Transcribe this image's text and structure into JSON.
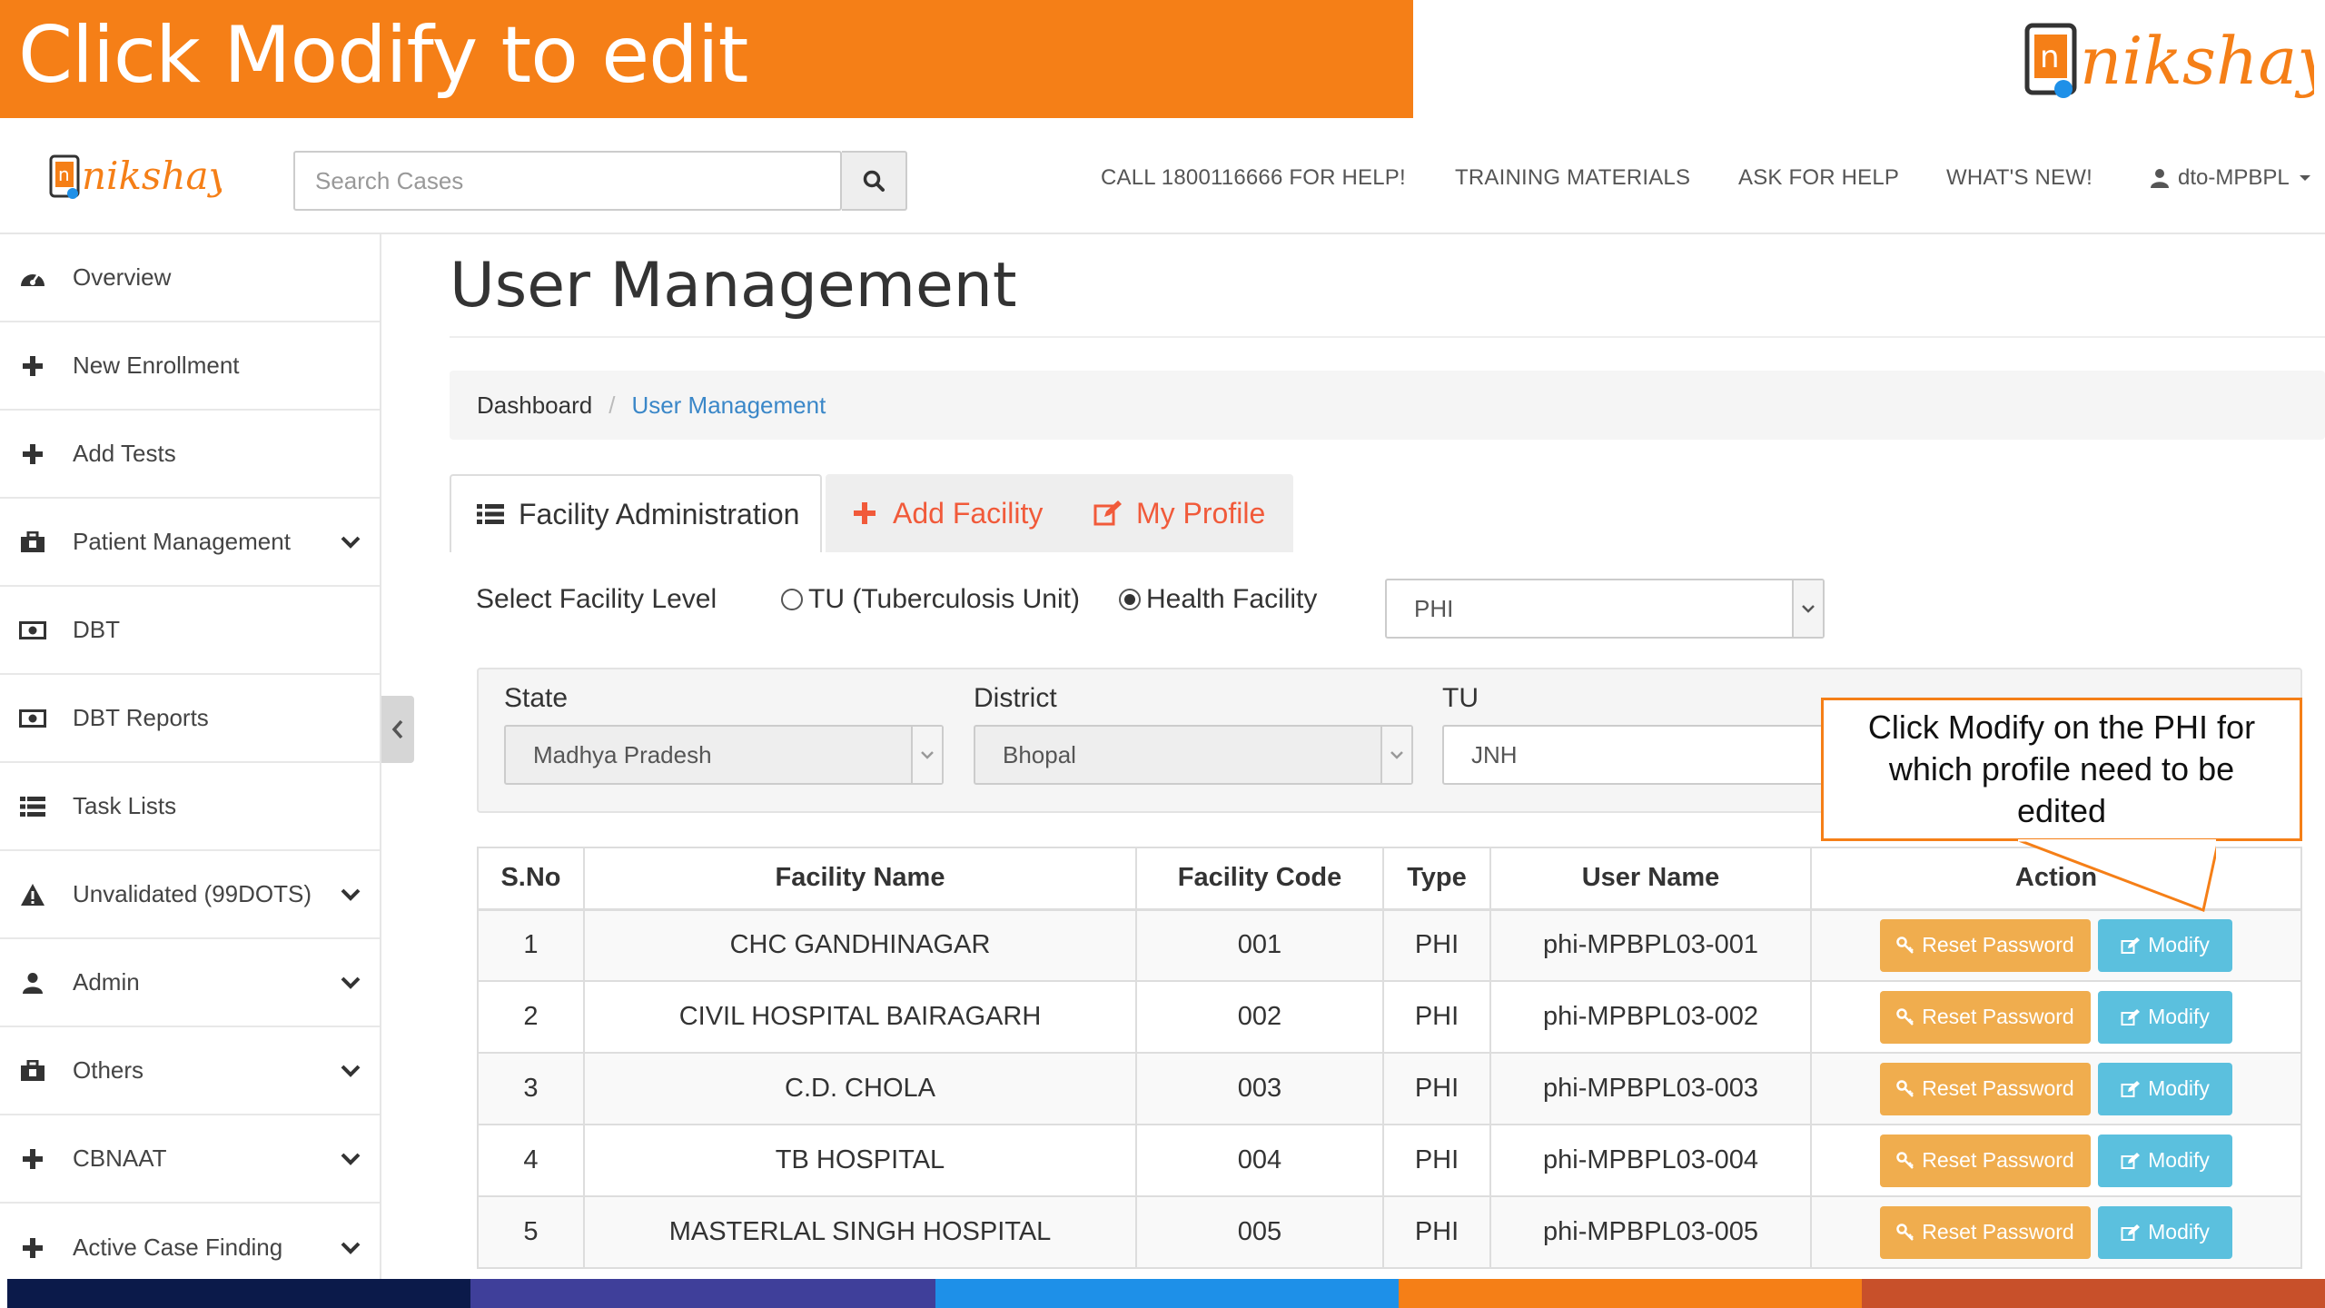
{
  "banner": {
    "text": "Click Modify to edit"
  },
  "brand": {
    "logo_text": "nikshay"
  },
  "header": {
    "search_placeholder": "Search Cases",
    "links": [
      "CALL 1800116666 FOR HELP!",
      "TRAINING MATERIALS",
      "ASK FOR HELP",
      "WHAT'S NEW!"
    ],
    "user": "dto-MPBPL"
  },
  "sidebar": {
    "items": [
      {
        "label": "Overview",
        "icon": "dashboard-icon",
        "expandable": false
      },
      {
        "label": "New Enrollment",
        "icon": "plus-icon",
        "expandable": false
      },
      {
        "label": "Add Tests",
        "icon": "plus-icon",
        "expandable": false
      },
      {
        "label": "Patient Management",
        "icon": "briefcase-icon",
        "expandable": true
      },
      {
        "label": "DBT",
        "icon": "money-icon",
        "expandable": false
      },
      {
        "label": "DBT Reports",
        "icon": "money-icon",
        "expandable": false
      },
      {
        "label": "Task Lists",
        "icon": "list-icon",
        "expandable": false
      },
      {
        "label": "Unvalidated (99DOTS)",
        "icon": "warning-icon",
        "expandable": true
      },
      {
        "label": "Admin",
        "icon": "user-icon",
        "expandable": true
      },
      {
        "label": "Others",
        "icon": "briefcase-icon",
        "expandable": true
      },
      {
        "label": "CBNAAT",
        "icon": "plus-icon",
        "expandable": true
      },
      {
        "label": "Active Case Finding",
        "icon": "plus-icon",
        "expandable": true
      }
    ]
  },
  "main": {
    "title": "User Management",
    "breadcrumb": {
      "home": "Dashboard",
      "separator": "/",
      "current": "User Management"
    },
    "tabs": {
      "facility_admin": "Facility Administration",
      "add_facility": "Add Facility",
      "my_profile": "My Profile"
    },
    "level": {
      "label": "Select Facility Level",
      "option_tu": "TU (Tuberculosis Unit)",
      "option_hf": "Health Facility",
      "selected": "Health Facility",
      "type_value": "PHI"
    },
    "filters": {
      "state_label": "State",
      "state_value": "Madhya Pradesh",
      "district_label": "District",
      "district_value": "Bhopal",
      "tu_label": "TU",
      "tu_value": "JNH"
    },
    "table": {
      "headers": [
        "S.No",
        "Facility Name",
        "Facility Code",
        "Type",
        "User Name",
        "Action"
      ],
      "rows": [
        {
          "sno": "1",
          "name": "CHC GANDHINAGAR",
          "code": "001",
          "type": "PHI",
          "user": "phi-MPBPL03-001"
        },
        {
          "sno": "2",
          "name": "CIVIL HOSPITAL BAIRAGARH",
          "code": "002",
          "type": "PHI",
          "user": "phi-MPBPL03-002"
        },
        {
          "sno": "3",
          "name": "C.D. CHOLA",
          "code": "003",
          "type": "PHI",
          "user": "phi-MPBPL03-003"
        },
        {
          "sno": "4",
          "name": "TB HOSPITAL",
          "code": "004",
          "type": "PHI",
          "user": "phi-MPBPL03-004"
        },
        {
          "sno": "5",
          "name": "MASTERLAL SINGH HOSPITAL",
          "code": "005",
          "type": "PHI",
          "user": "phi-MPBPL03-005"
        }
      ],
      "reset_label": "Reset Password",
      "modify_label": "Modify"
    }
  },
  "callout": {
    "text": "Click Modify on the PHI for which profile need to be edited"
  },
  "colors": {
    "banner": "#f57f17",
    "accent_red": "#f15a3a",
    "reset_button": "#f0ad4e",
    "modify_button": "#5bc0de",
    "link": "#3a87c8",
    "footer": [
      "#0b1a4a",
      "#3f3f9a",
      "#1e90e8",
      "#f57f17",
      "#c8502a"
    ]
  }
}
